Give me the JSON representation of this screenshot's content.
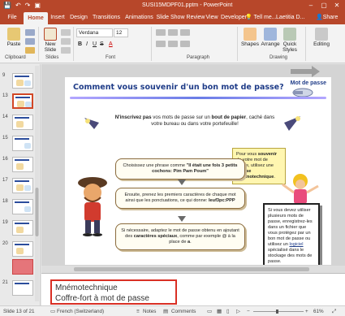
{
  "window": {
    "title": "SUSI15MDPF01.pptm - PowerPoint",
    "controls": [
      "–",
      "▢",
      "✕"
    ]
  },
  "qat": {
    "save_icon": "save-icon",
    "undo_icon": "undo-icon",
    "redo_icon": "redo-icon",
    "present_icon": "present-icon"
  },
  "tabs": [
    "File",
    "Home",
    "Insert",
    "Design",
    "Transitions",
    "Animations",
    "Slide Show",
    "Review",
    "View",
    "Developer"
  ],
  "active_tab": "Home",
  "tell_me": "Tell me...",
  "user": "Laetitia D...",
  "share": "Share",
  "ribbon": {
    "clipboard": {
      "label": "Clipboard",
      "paste": "Paste"
    },
    "slides": {
      "label": "Slides",
      "new_slide": "New Slide"
    },
    "font": {
      "label": "Font",
      "name": "Verdana",
      "size": "12",
      "bold": "B",
      "italic": "I",
      "underline": "U",
      "strike": "S",
      "color_a": "A"
    },
    "paragraph": {
      "label": "Paragraph"
    },
    "drawing": {
      "label": "Drawing",
      "shapes": "Shapes",
      "arrange": "Arrange",
      "quick_styles": "Quick Styles"
    },
    "editing": {
      "label": "Editing"
    }
  },
  "thumbnails": [
    {
      "num": "9"
    },
    {
      "num": "10"
    },
    {
      "num": "11"
    },
    {
      "num": "12"
    },
    {
      "num": "13"
    },
    {
      "num": "14"
    },
    {
      "num": "15"
    },
    {
      "num": "16"
    },
    {
      "num": "17"
    },
    {
      "num": "18"
    },
    {
      "num": "19"
    },
    {
      "num": "20"
    },
    {
      "num": "21"
    }
  ],
  "selected_slide": "13",
  "slide": {
    "title": "Comment vous souvenir d'un bon mot de passe?",
    "corner_label": "Mot de passe",
    "intro_bold": "N'inscrivez pas",
    "intro_a": " vos mots de passe sur un ",
    "intro_bold2": "bout de papier",
    "intro_b": ", caché dans votre bureau ou dans votre portefeuille!",
    "step1_a": "Choisissez une phrase comme ",
    "step1_bold": "\"Il était une fois 3 petits cochons: Pim Pam Poum\"",
    "step2_a": "Ensuite, prenez les premiers caractères de chaque mot ainsi que les ponctuations, ce qui donne: ",
    "step2_bold": "Ieuf3pc:PPP",
    "step3_a": "Si nécessaire, adaptez le mot de passe obtenu en ajoutant des ",
    "step3_bold": "caractères spéciaux",
    "step3_b": ", comme par exemple @ à la place de ",
    "step3_bold2": "a",
    "step3_c": ".",
    "tip_right_a": "Pour vous ",
    "tip_right_bold": "souvenir",
    "tip_right_b": " de votre mot de passe, utilisez une ",
    "tip_right_bold2": "phrase mnémotechnique",
    "tip_right_c": ".",
    "tip_bottom_a": "Si vous devez utiliser plusieurs mots de passe, enregistrez-les dans un fichier que vous protégez par un bon mot de passe ou utilisez un ",
    "tip_bottom_link": "logiciel",
    "tip_bottom_b": " spécialisé dans le stockage des mots de passe."
  },
  "notes": {
    "line1": "Mnémotechnique",
    "line2": "Coffre-fort à mot de passe"
  },
  "status": {
    "slide_of": "Slide 13 of 21",
    "language": "French (Switzerland)",
    "notes": "Notes",
    "comments": "Comments",
    "zoom": "61%"
  },
  "colors": {
    "accent": "#b7472a",
    "title_blue": "#1f3c88",
    "notes_highlight": "#d93025"
  }
}
